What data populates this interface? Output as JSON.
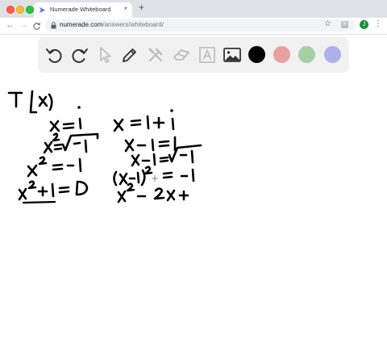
{
  "tab": {
    "title": "Numerade Whiteboard",
    "close": "×"
  },
  "new_tab": "+",
  "nav": {
    "back": "←",
    "forward": "→",
    "reload": "C"
  },
  "address": {
    "host": "numerade.com",
    "path": "/answers/whiteboard/"
  },
  "browser_icons": {
    "star": "☆",
    "extension": "N",
    "avatar": "J",
    "menu": "⋮"
  },
  "whiteboard": {
    "tools": [
      "undo-icon",
      "redo-icon",
      "pointer-icon",
      "pen-icon",
      "tools-icon",
      "eraser-icon",
      "text-icon",
      "image-icon"
    ],
    "colors": [
      "#000000",
      "#e8a0a0",
      "#a6cfa6",
      "#aeb0e8"
    ]
  },
  "handwriting": {
    "label_t": "T",
    "left_column": [
      "x = i",
      "x² = √-1",
      "x² = -1",
      "x² + 1 = 0"
    ],
    "right_column": [
      "x = 1 + i",
      "x - 1 = i",
      "x - 1 = √-1",
      "(x-1)² = -1",
      "x² - 2x +"
    ]
  }
}
